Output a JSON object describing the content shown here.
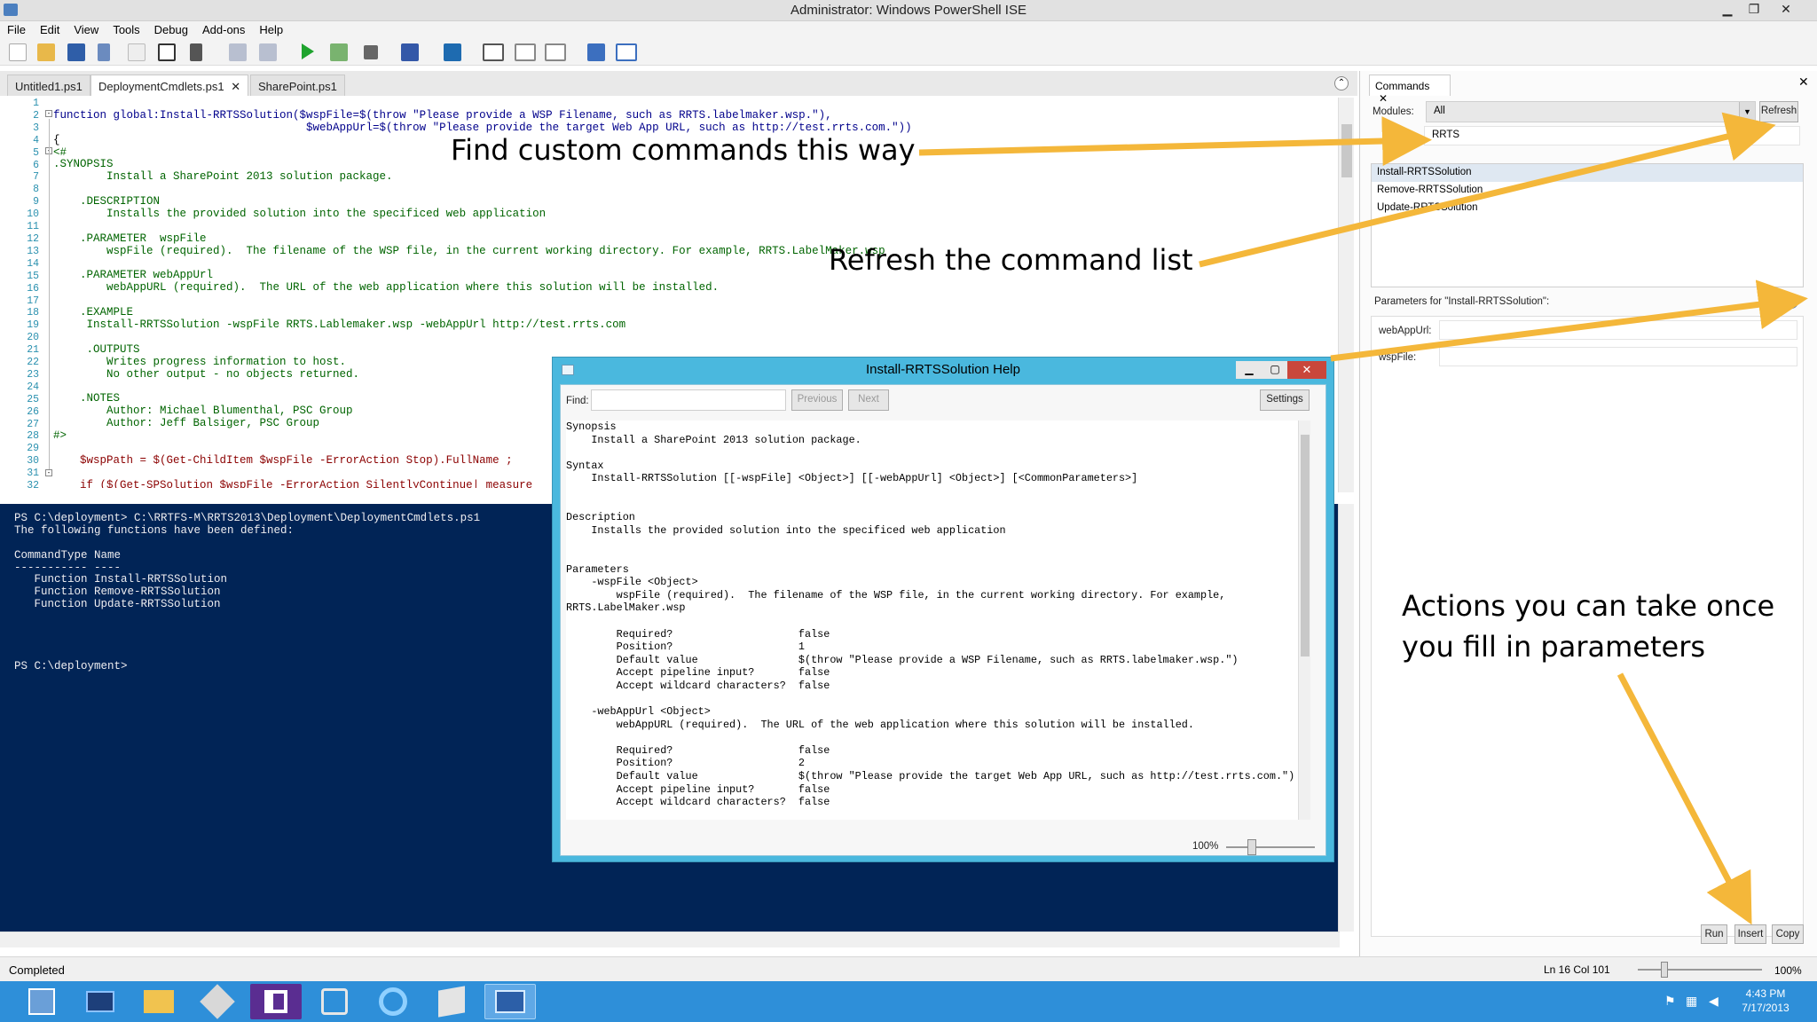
{
  "window": {
    "title": "Administrator: Windows PowerShell ISE",
    "min": "▁",
    "max": "❐",
    "close": "✕"
  },
  "menu": [
    "File",
    "Edit",
    "View",
    "Tools",
    "Debug",
    "Add-ons",
    "Help"
  ],
  "tabs": [
    {
      "label": "Untitled1.ps1"
    },
    {
      "label": "DeploymentCmdlets.ps1",
      "close": "✕"
    },
    {
      "label": "SharePoint.ps1"
    }
  ],
  "editor": {
    "line_numbers": "1\n2\n3\n4\n5\n6\n7\n8\n9\n10\n11\n12\n13\n14\n15\n16\n17\n18\n19\n20\n21\n22\n23\n24\n25\n26\n27\n28\n29\n30\n31\n32",
    "lines": [
      "",
      "function global:Install-RRTSSolution($wspFile=$(throw \"Please provide a WSP Filename, such as RRTS.labelmaker.wsp.\"),",
      "                                      $webAppUrl=$(throw \"Please provide the target Web App URL, such as http://test.rrts.com.\"))",
      "{",
      "<#",
      ".SYNOPSIS",
      "        Install a SharePoint 2013 solution package.",
      "",
      "    .DESCRIPTION",
      "        Installs the provided solution into the specificed web application",
      "",
      "    .PARAMETER  wspFile",
      "        wspFile (required).  The filename of the WSP file, in the current working directory. For example, RRTS.LabelMaker.wsp",
      "",
      "    .PARAMETER webAppUrl",
      "        webAppURL (required).  The URL of the web application where this solution will be installed.",
      "",
      "    .EXAMPLE",
      "     Install-RRTSSolution -wspFile RRTS.Lablemaker.wsp -webAppUrl http://test.rrts.com",
      "",
      "     .OUTPUTS",
      "        Writes progress information to host.",
      "        No other output - no objects returned.",
      "",
      "    .NOTES",
      "        Author: Michael Blumenthal, PSC Group",
      "        Author: Jeff Balsiger, PSC Group",
      "#>",
      "",
      "    $wspPath = $(Get-ChildItem $wspFile -ErrorAction Stop).FullName ;",
      "",
      "    if ($(Get-SPSolution $wspFile -ErrorAction SilentlyContinue| measure"
    ]
  },
  "console": {
    "lines": [
      "PS C:\\deployment> C:\\RRTFS-M\\RRTS2013\\Deployment\\DeploymentCmdlets.ps1",
      "The following functions have been defined:",
      "",
      "CommandType Name",
      "----------- ----",
      "   Function Install-RRTSSolution",
      "   Function Remove-RRTSSolution",
      "   Function Update-RRTSSolution",
      "",
      "",
      "",
      "",
      "PS C:\\deployment>"
    ]
  },
  "status": {
    "left": "Completed",
    "position": "Ln 16  Col 101",
    "zoom": "100%"
  },
  "commands": {
    "tab_label": "Commands",
    "tab_close": "✕",
    "panel_close": "✕",
    "modules_label": "Modules:",
    "modules_value": "All",
    "refresh_label": "Refresh",
    "name_value": "RRTS",
    "list": [
      "Install-RRTSSolution",
      "Remove-RRTSSolution",
      "Update-RRTSSolution"
    ],
    "params_label": "Parameters for \"Install-RRTSSolution\":",
    "help_icon": "?",
    "params": [
      {
        "name": "webAppUrl:"
      },
      {
        "name": "wspFile:"
      }
    ],
    "buttons": {
      "run": "Run",
      "insert": "Insert",
      "copy": "Copy"
    }
  },
  "help": {
    "title": "Install-RRTSSolution Help",
    "find_label": "Find:",
    "previous": "Previous",
    "next": "Next",
    "settings": "Settings",
    "zoom": "100%",
    "text": "Synopsis\n    Install a SharePoint 2013 solution package.\n\nSyntax\n    Install-RRTSSolution [[-wspFile] <Object>] [[-webAppUrl] <Object>] [<CommonParameters>]\n\n\nDescription\n    Installs the provided solution into the specificed web application\n\n\nParameters\n    -wspFile <Object>\n        wspFile (required).  The filename of the WSP file, in the current working directory. For example,\nRRTS.LabelMaker.wsp\n\n        Required?                    false\n        Position?                    1\n        Default value                $(throw \"Please provide a WSP Filename, such as RRTS.labelmaker.wsp.\")\n        Accept pipeline input?       false\n        Accept wildcard characters?  false\n\n    -webAppUrl <Object>\n        webAppURL (required).  The URL of the web application where this solution will be installed.\n\n        Required?                    false\n        Position?                    2\n        Default value                $(throw \"Please provide the target Web App URL, such as http://test.rrts.com.\")\n        Accept pipeline input?       false\n        Accept wildcard characters?  false"
  },
  "annotations": {
    "find": "Find custom commands this way",
    "refresh": "Refresh the command list",
    "actions_1": "Actions you can take once",
    "actions_2": "you fill in parameters",
    "arrow_color": "#f4b73a"
  },
  "clock": {
    "time": "4:43 PM",
    "date": "7/17/2013"
  },
  "taskbar_apps": [
    "server-manager-icon",
    "powershell-icon",
    "explorer-icon",
    "tools-icon",
    "visual-studio-icon",
    "admin-tools-icon",
    "ie-icon",
    "notepad-icon",
    "powershell-ise-icon"
  ]
}
